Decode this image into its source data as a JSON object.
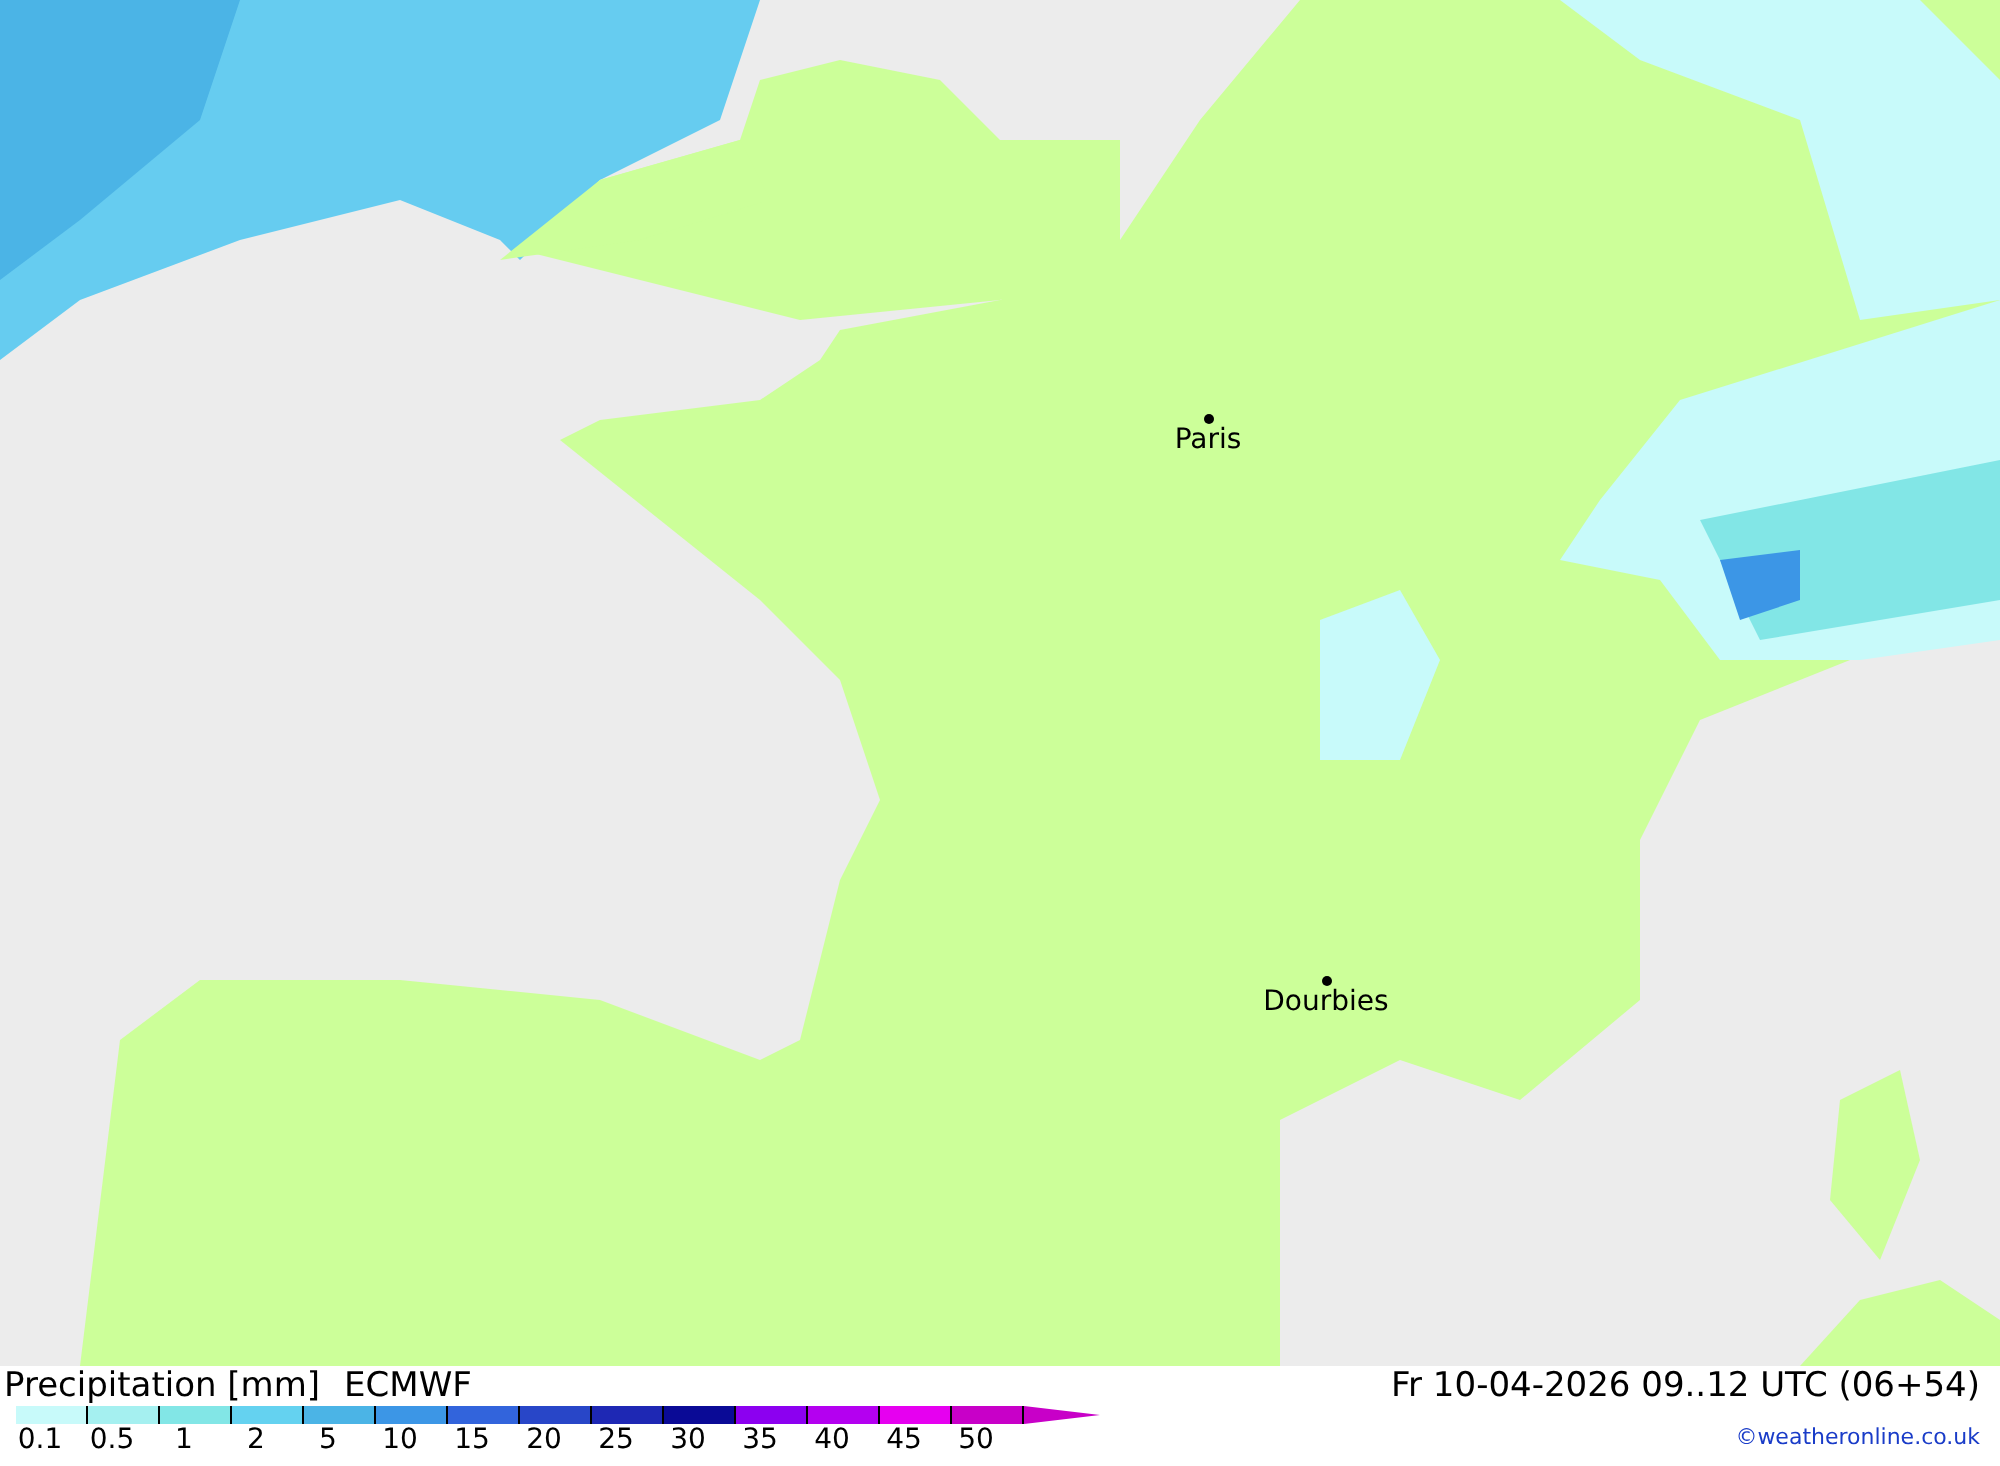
{
  "map": {
    "cities": [
      {
        "name": "Paris"
      },
      {
        "name": "Dourbies"
      }
    ]
  },
  "legend": {
    "title": "Precipitation [mm]",
    "model": "ECMWF",
    "valid_time": "Fr 10-04-2026 09..12 UTC (06+54)",
    "scale": [
      {
        "label": "0.1",
        "color": "#c8fafa"
      },
      {
        "label": "0.5",
        "color": "#a5f0f0"
      },
      {
        "label": "1",
        "color": "#82e6e6"
      },
      {
        "label": "2",
        "color": "#64d2f0"
      },
      {
        "label": "5",
        "color": "#4bb4e6"
      },
      {
        "label": "10",
        "color": "#3c96e6"
      },
      {
        "label": "15",
        "color": "#3264dc"
      },
      {
        "label": "20",
        "color": "#2846c8"
      },
      {
        "label": "25",
        "color": "#1e28b4"
      },
      {
        "label": "30",
        "color": "#0a0a96"
      },
      {
        "label": "35",
        "color": "#8c00f0"
      },
      {
        "label": "40",
        "color": "#b400f0"
      },
      {
        "label": "45",
        "color": "#e600f0"
      },
      {
        "label": "50",
        "color": "#c800c8"
      }
    ],
    "credit": "©weatheronline.co.uk"
  }
}
